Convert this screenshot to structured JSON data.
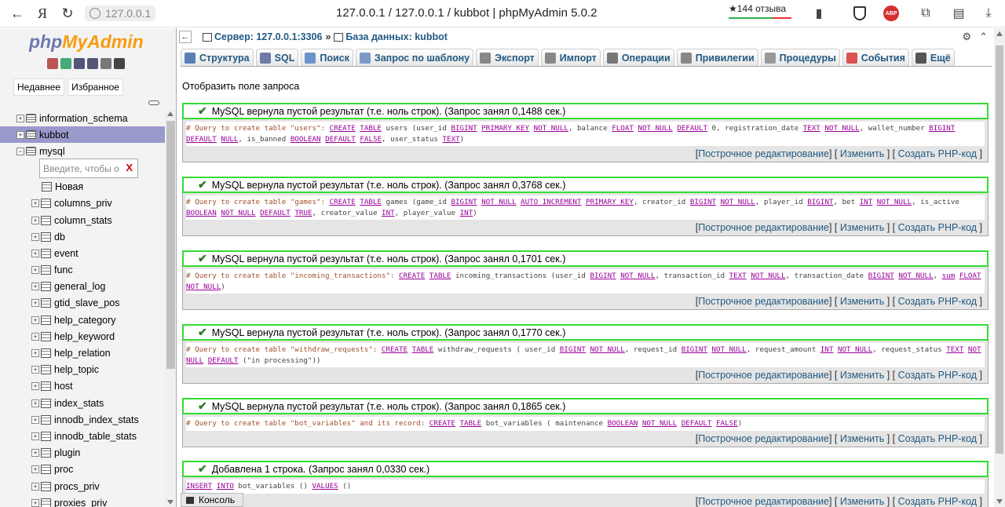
{
  "browser": {
    "host": "127.0.0.1",
    "page_title": "127.0.0.1 / 127.0.0.1 / kubbot | phpMyAdmin 5.0.2",
    "reviews": "★144 отзыва",
    "yandex": "Я",
    "abp": "ABP"
  },
  "sidebar": {
    "logo_php": "php",
    "logo_my": "MyAdmin",
    "tabs": [
      "Недавнее",
      "Избранное"
    ],
    "filter_placeholder": "Введите, чтобы о",
    "filter_clear": "X",
    "databases": [
      "information_schema",
      "kubbot",
      "mysql"
    ],
    "new_label": "Новая",
    "tables": [
      "columns_priv",
      "column_stats",
      "db",
      "event",
      "func",
      "general_log",
      "gtid_slave_pos",
      "help_category",
      "help_keyword",
      "help_relation",
      "help_topic",
      "host",
      "index_stats",
      "innodb_index_stats",
      "innodb_table_stats",
      "plugin",
      "proc",
      "procs_priv",
      "proxies_priv"
    ]
  },
  "breadcrumb": {
    "server": "Сервер: 127.0.0.1:3306",
    "sep": "»",
    "database": "База данных: kubbot"
  },
  "menu": [
    {
      "label": "Структура",
      "color": "#5a7fb5"
    },
    {
      "label": "SQL",
      "color": "#6d7ba8"
    },
    {
      "label": "Поиск",
      "color": "#6b93c9"
    },
    {
      "label": "Запрос по шаблону",
      "color": "#7c9bc7"
    },
    {
      "label": "Экспорт",
      "color": "#888888"
    },
    {
      "label": "Импорт",
      "color": "#888888"
    },
    {
      "label": "Операции",
      "color": "#777777"
    },
    {
      "label": "Привилегии",
      "color": "#888888"
    },
    {
      "label": "Процедуры",
      "color": "#999999"
    },
    {
      "label": "События",
      "color": "#d9534f"
    },
    {
      "label": "Ещё",
      "color": "#555555"
    }
  ],
  "show_query": "Отобразить поле запроса",
  "links": {
    "inline_edit": "Построчное редактирование",
    "edit": "Изменить",
    "create_php": "Создать PHP-код"
  },
  "results": [
    {
      "message": "MySQL вернула пустой результат (т.е. ноль строк). (Запрос занял 0,1488 сек.)",
      "sql": [
        [
          "cm",
          "# Query to create table \"users\": "
        ],
        [
          "kw",
          "CREATE"
        ],
        [
          "t",
          " "
        ],
        [
          "kw",
          "TABLE"
        ],
        [
          "t",
          " users (user_id "
        ],
        [
          "kw",
          "BIGINT"
        ],
        [
          "t",
          " "
        ],
        [
          "kw",
          "PRIMARY KEY"
        ],
        [
          "t",
          " "
        ],
        [
          "kw",
          "NOT NULL"
        ],
        [
          "t",
          ", balance "
        ],
        [
          "kw",
          "FLOAT"
        ],
        [
          "t",
          " "
        ],
        [
          "kw",
          "NOT NULL"
        ],
        [
          "t",
          " "
        ],
        [
          "kw",
          "DEFAULT"
        ],
        [
          "t",
          " 0, registration_date "
        ],
        [
          "kw",
          "TEXT"
        ],
        [
          "t",
          " "
        ],
        [
          "kw",
          "NOT NULL"
        ],
        [
          "t",
          ", wallet_number "
        ],
        [
          "kw",
          "BIGINT"
        ],
        [
          "t",
          " "
        ],
        [
          "kw",
          "DEFAULT"
        ],
        [
          "t",
          " "
        ],
        [
          "kw",
          "NULL"
        ],
        [
          "t",
          ", is_banned "
        ],
        [
          "kw",
          "BOOLEAN"
        ],
        [
          "t",
          " "
        ],
        [
          "kw",
          "DEFAULT"
        ],
        [
          "t",
          " "
        ],
        [
          "kw",
          "FALSE"
        ],
        [
          "t",
          ", user_status "
        ],
        [
          "kw",
          "TEXT"
        ],
        [
          "t",
          ")"
        ]
      ]
    },
    {
      "message": "MySQL вернула пустой результат (т.е. ноль строк). (Запрос занял 0,3768 сек.)",
      "sql": [
        [
          "cm",
          "# Query to create table \"games\": "
        ],
        [
          "kw",
          "CREATE"
        ],
        [
          "t",
          " "
        ],
        [
          "kw",
          "TABLE"
        ],
        [
          "t",
          " games (game_id "
        ],
        [
          "kw",
          "BIGINT"
        ],
        [
          "t",
          " "
        ],
        [
          "kw",
          "NOT NULL"
        ],
        [
          "t",
          " "
        ],
        [
          "kw",
          "AUTO_INCREMENT"
        ],
        [
          "t",
          " "
        ],
        [
          "kw",
          "PRIMARY KEY"
        ],
        [
          "t",
          ", creator_id "
        ],
        [
          "kw",
          "BIGINT"
        ],
        [
          "t",
          " "
        ],
        [
          "kw",
          "NOT NULL"
        ],
        [
          "t",
          ", player_id "
        ],
        [
          "kw",
          "BIGINT"
        ],
        [
          "t",
          ", bet "
        ],
        [
          "kw",
          "INT"
        ],
        [
          "t",
          " "
        ],
        [
          "kw",
          "NOT NULL"
        ],
        [
          "t",
          ", is_active "
        ],
        [
          "kw",
          "BOOLEAN"
        ],
        [
          "t",
          " "
        ],
        [
          "kw",
          "NOT NULL"
        ],
        [
          "t",
          " "
        ],
        [
          "kw",
          "DEFAULT"
        ],
        [
          "t",
          " "
        ],
        [
          "kw",
          "TRUE"
        ],
        [
          "t",
          ", creator_value "
        ],
        [
          "kw",
          "INT"
        ],
        [
          "t",
          ", player_value "
        ],
        [
          "kw",
          "INT"
        ],
        [
          "t",
          ")"
        ]
      ]
    },
    {
      "message": "MySQL вернула пустой результат (т.е. ноль строк). (Запрос занял 0,1701 сек.)",
      "sql": [
        [
          "cm",
          "# Query to create table \"incoming_transactions\": "
        ],
        [
          "kw",
          "CREATE"
        ],
        [
          "t",
          " "
        ],
        [
          "kw",
          "TABLE"
        ],
        [
          "t",
          " incoming_transactions (user_id "
        ],
        [
          "kw",
          "BIGINT"
        ],
        [
          "t",
          " "
        ],
        [
          "kw",
          "NOT NULL"
        ],
        [
          "t",
          ", transaction_id "
        ],
        [
          "kw",
          "TEXT"
        ],
        [
          "t",
          " "
        ],
        [
          "kw",
          "NOT NULL"
        ],
        [
          "t",
          ", transaction_date "
        ],
        [
          "kw",
          "BIGINT"
        ],
        [
          "t",
          " "
        ],
        [
          "kw",
          "NOT NULL"
        ],
        [
          "t",
          ", "
        ],
        [
          "kw",
          "sum"
        ],
        [
          "t",
          " "
        ],
        [
          "kw",
          "FLOAT"
        ],
        [
          "t",
          " "
        ],
        [
          "kw",
          "NOT NULL"
        ],
        [
          "t",
          ")"
        ]
      ]
    },
    {
      "message": "MySQL вернула пустой результат (т.е. ноль строк). (Запрос занял 0,1770 сек.)",
      "sql": [
        [
          "cm",
          "# Query to create table \"withdraw_requests\": "
        ],
        [
          "kw",
          "CREATE"
        ],
        [
          "t",
          " "
        ],
        [
          "kw",
          "TABLE"
        ],
        [
          "t",
          " withdraw_requests ( user_id "
        ],
        [
          "kw",
          "BIGINT"
        ],
        [
          "t",
          " "
        ],
        [
          "kw",
          "NOT NULL"
        ],
        [
          "t",
          ", request_id "
        ],
        [
          "kw",
          "BIGINT"
        ],
        [
          "t",
          " "
        ],
        [
          "kw",
          "NOT NULL"
        ],
        [
          "t",
          ", request_amount "
        ],
        [
          "kw",
          "INT"
        ],
        [
          "t",
          " "
        ],
        [
          "kw",
          "NOT NULL"
        ],
        [
          "t",
          ", request_status "
        ],
        [
          "kw",
          "TEXT"
        ],
        [
          "t",
          " "
        ],
        [
          "kw",
          "NOT NULL"
        ],
        [
          "t",
          " "
        ],
        [
          "kw",
          "DEFAULT"
        ],
        [
          "t",
          " (\"in processing\"))"
        ]
      ]
    },
    {
      "message": "MySQL вернула пустой результат (т.е. ноль строк). (Запрос занял 0,1865 сек.)",
      "sql": [
        [
          "cm",
          "# Query to create table \"bot_variables\" and its record: "
        ],
        [
          "kw",
          "CREATE"
        ],
        [
          "t",
          " "
        ],
        [
          "kw",
          "TABLE"
        ],
        [
          "t",
          " bot_variables ( maintenance "
        ],
        [
          "kw",
          "BOOLEAN"
        ],
        [
          "t",
          " "
        ],
        [
          "kw",
          "NOT NULL"
        ],
        [
          "t",
          " "
        ],
        [
          "kw",
          "DEFAULT"
        ],
        [
          "t",
          " "
        ],
        [
          "kw",
          "FALSE"
        ],
        [
          "t",
          ")"
        ]
      ]
    },
    {
      "message": "Добавлена 1 строка. (Запрос занял 0,0330 сек.)",
      "sql": [
        [
          "kw",
          "INSERT"
        ],
        [
          "t",
          " "
        ],
        [
          "kw",
          "INTO"
        ],
        [
          "t",
          " bot_variables () "
        ],
        [
          "kw",
          "VALUES"
        ],
        [
          "t",
          " ()"
        ]
      ]
    }
  ],
  "console_label": "Консоль"
}
